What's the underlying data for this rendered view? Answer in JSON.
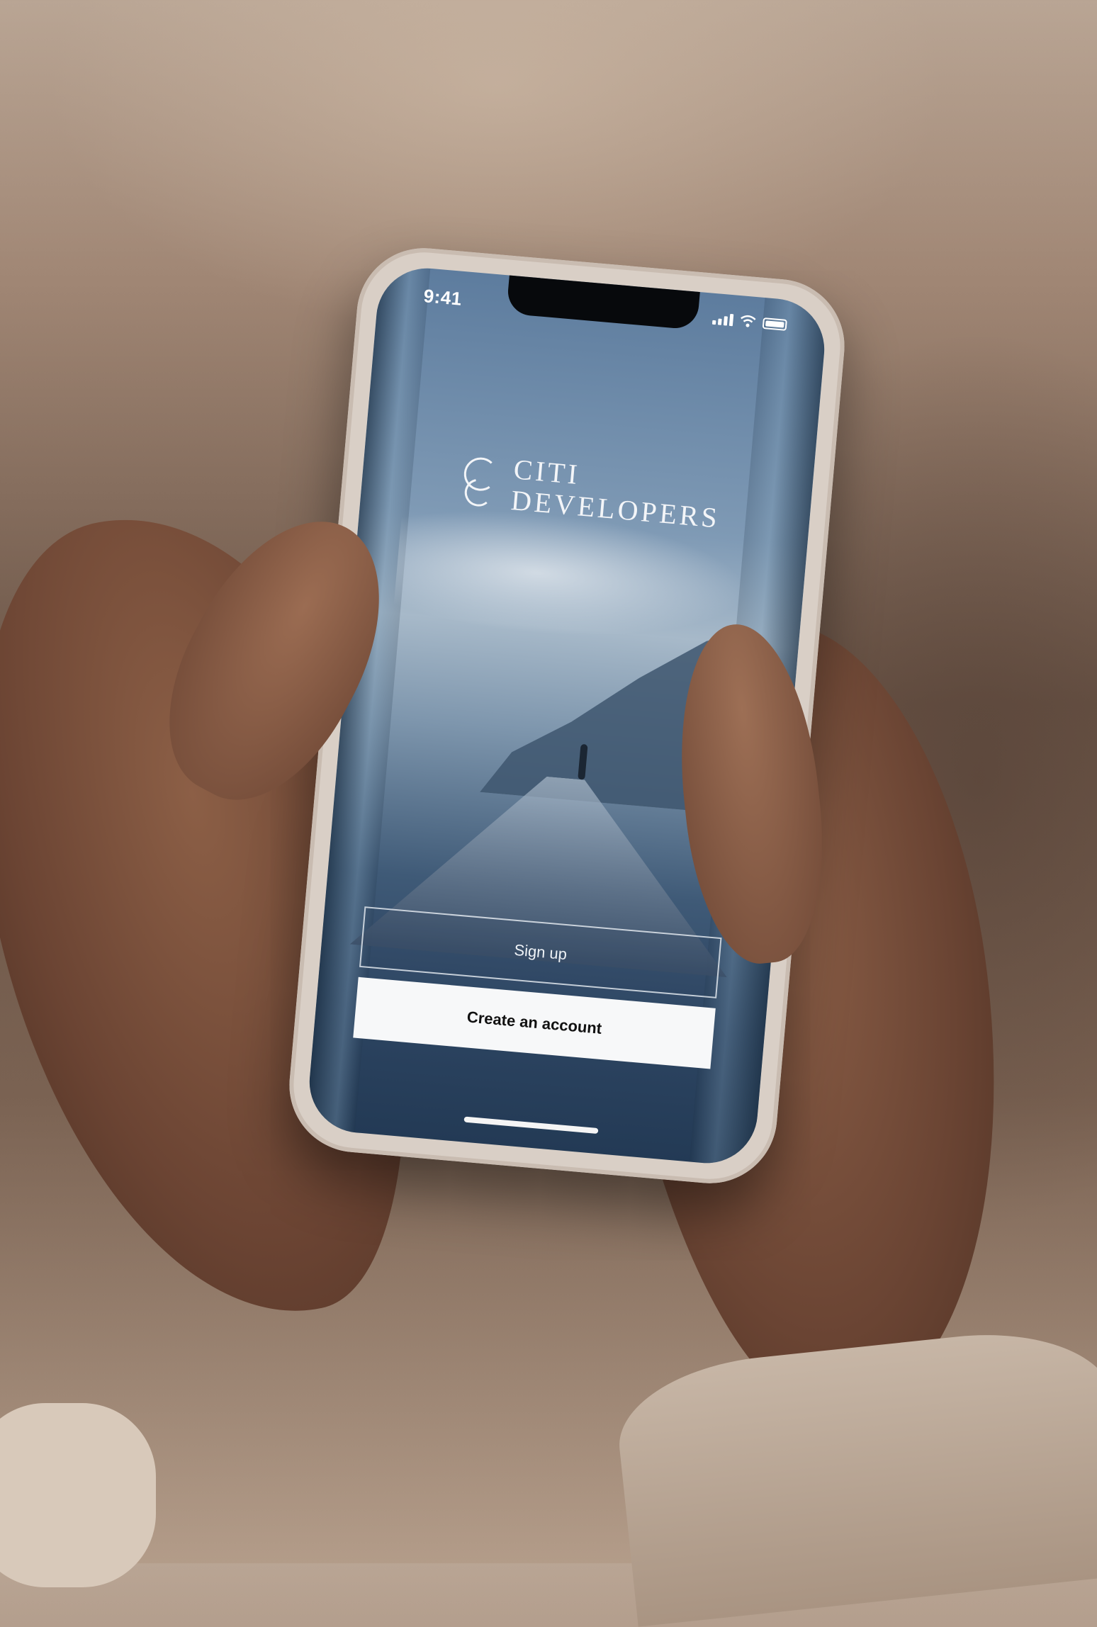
{
  "status_bar": {
    "time": "9:41"
  },
  "brand": {
    "line1": "CITI",
    "line2": "DEVELOPERS"
  },
  "actions": {
    "signup_label": "Sign up",
    "create_label": "Create an account"
  },
  "icons": {
    "brand_mark": "citi-developers-logo",
    "signal": "cellular-signal-icon",
    "wifi": "wifi-icon",
    "battery": "battery-icon"
  },
  "colors": {
    "create_button_bg": "#f7f8f9",
    "screen_sky": "#7f9ab5",
    "screen_water": "#2d4562"
  }
}
